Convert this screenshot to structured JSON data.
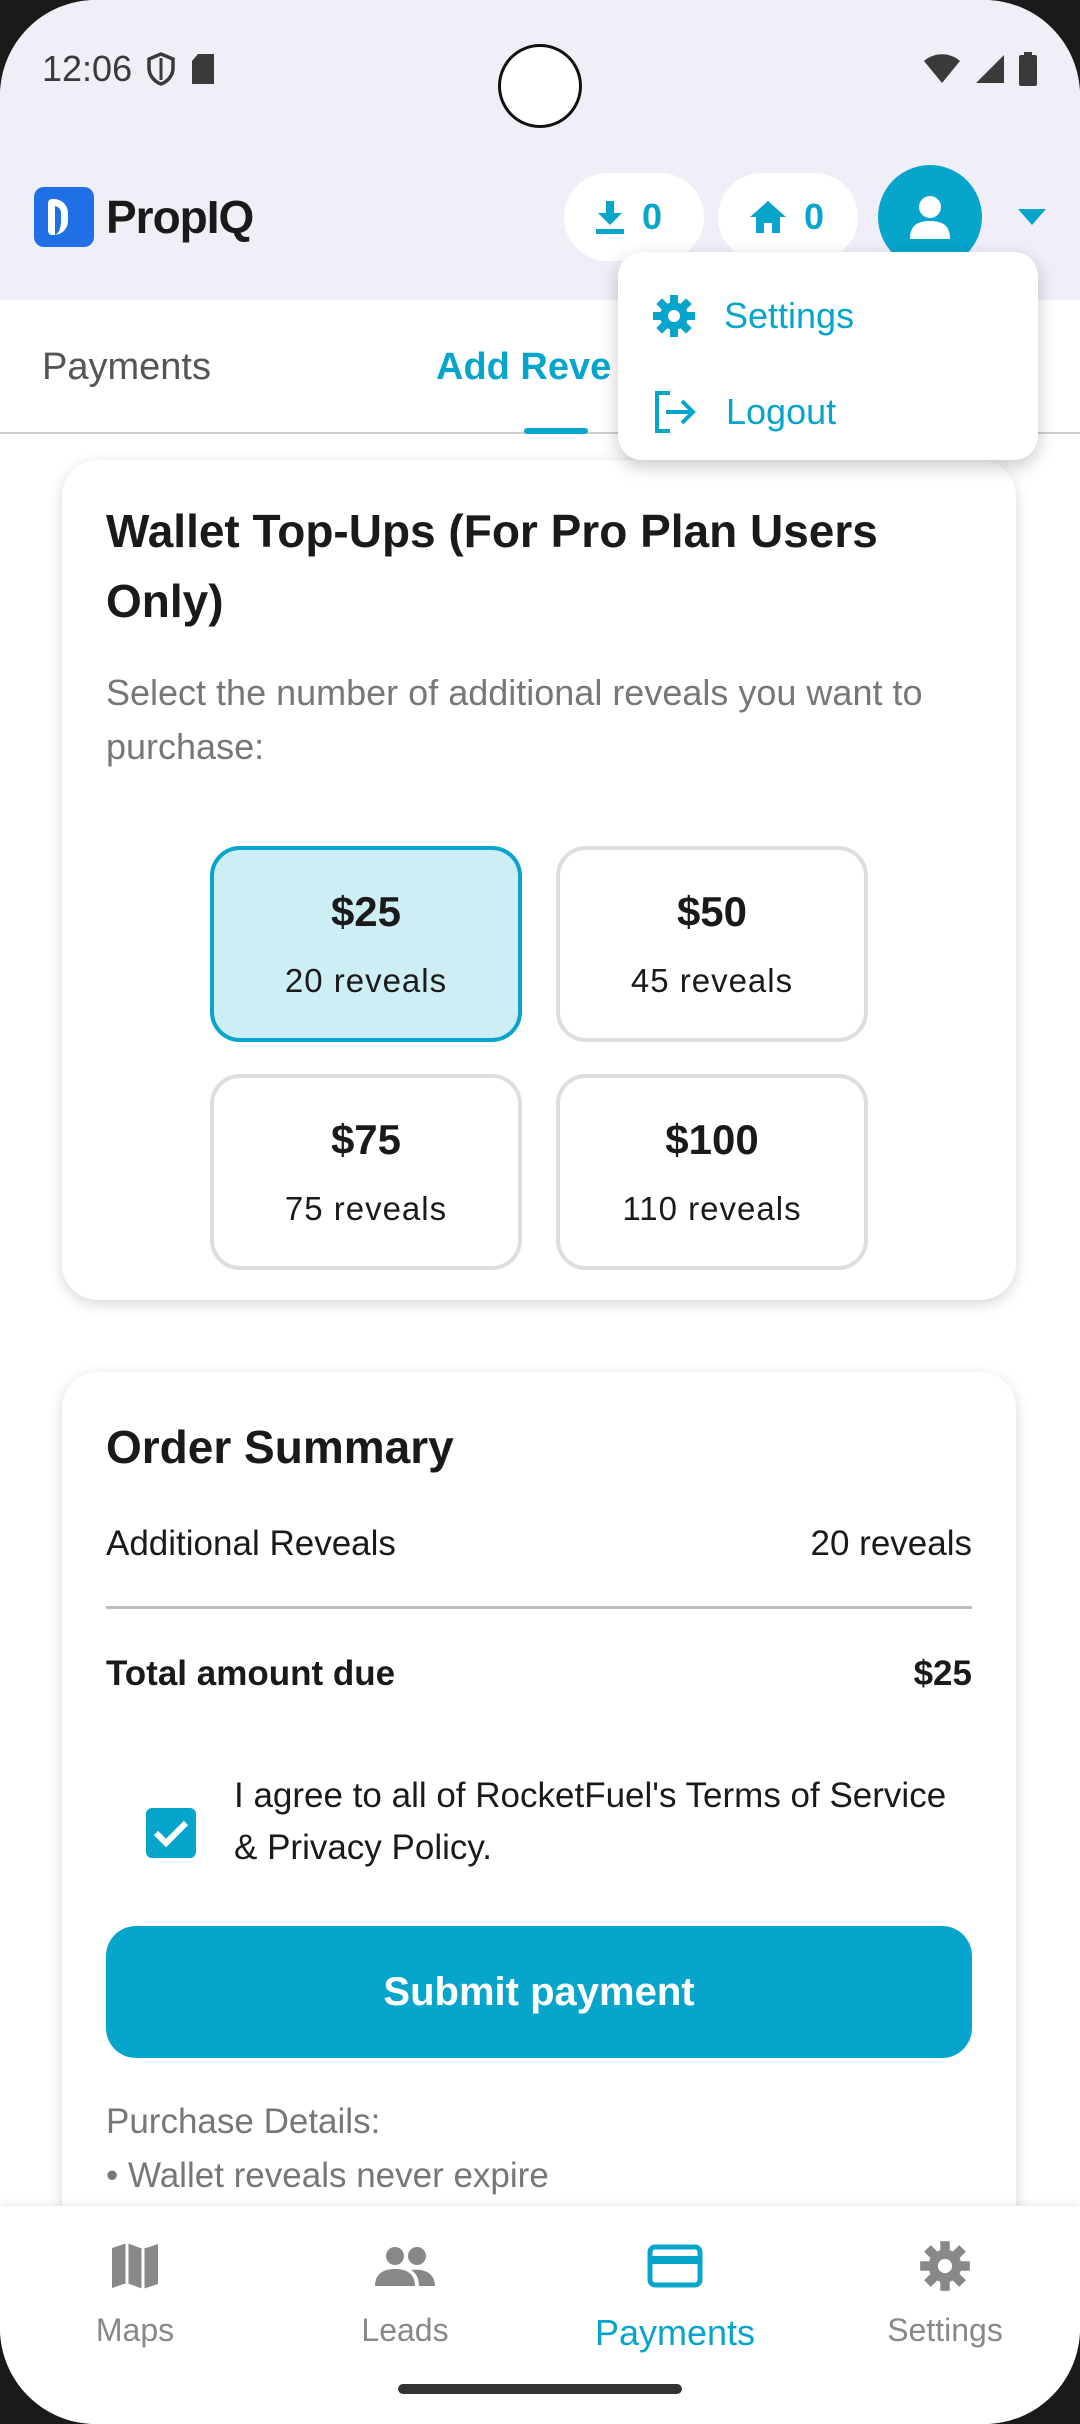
{
  "status_bar": {
    "time": "12:06"
  },
  "app_bar": {
    "brand": "PropIQ",
    "downloads_count": "0",
    "homes_count": "0"
  },
  "tabs": [
    {
      "label": "Payments"
    },
    {
      "label": "Add Reve"
    }
  ],
  "menu": {
    "items": [
      {
        "label": "Settings"
      },
      {
        "label": "Logout"
      }
    ]
  },
  "wallet": {
    "title": "Wallet Top-Ups (For Pro Plan Users Only)",
    "subtitle": "Select the number of additional reveals you want to purchase:",
    "options": [
      {
        "price": "$25",
        "reveals": "20 reveals",
        "selected": true
      },
      {
        "price": "$50",
        "reveals": "45 reveals",
        "selected": false
      },
      {
        "price": "$75",
        "reveals": "75 reveals",
        "selected": false
      },
      {
        "price": "$100",
        "reveals": "110 reveals",
        "selected": false
      }
    ]
  },
  "order": {
    "title": "Order Summary",
    "reveals_label": "Additional Reveals",
    "reveals_value": "20 reveals",
    "total_label": "Total amount due",
    "total_value": "$25",
    "agree_text": "I agree to all of RocketFuel's Terms of Service & Privacy Policy.",
    "agree_checked": true,
    "submit_label": "Submit payment",
    "details_heading": "Purchase Details:",
    "details_items": [
      "• Wallet reveals never expire"
    ]
  },
  "bottom_nav": [
    {
      "label": "Maps",
      "icon": "map-icon"
    },
    {
      "label": "Leads",
      "icon": "people-icon"
    },
    {
      "label": "Payments",
      "icon": "card-icon",
      "active": true
    },
    {
      "label": "Settings",
      "icon": "gear-icon"
    }
  ],
  "colors": {
    "accent": "#07a5cc",
    "selected_bg": "#cdeef5",
    "brand_blue": "#1f6fe5"
  }
}
